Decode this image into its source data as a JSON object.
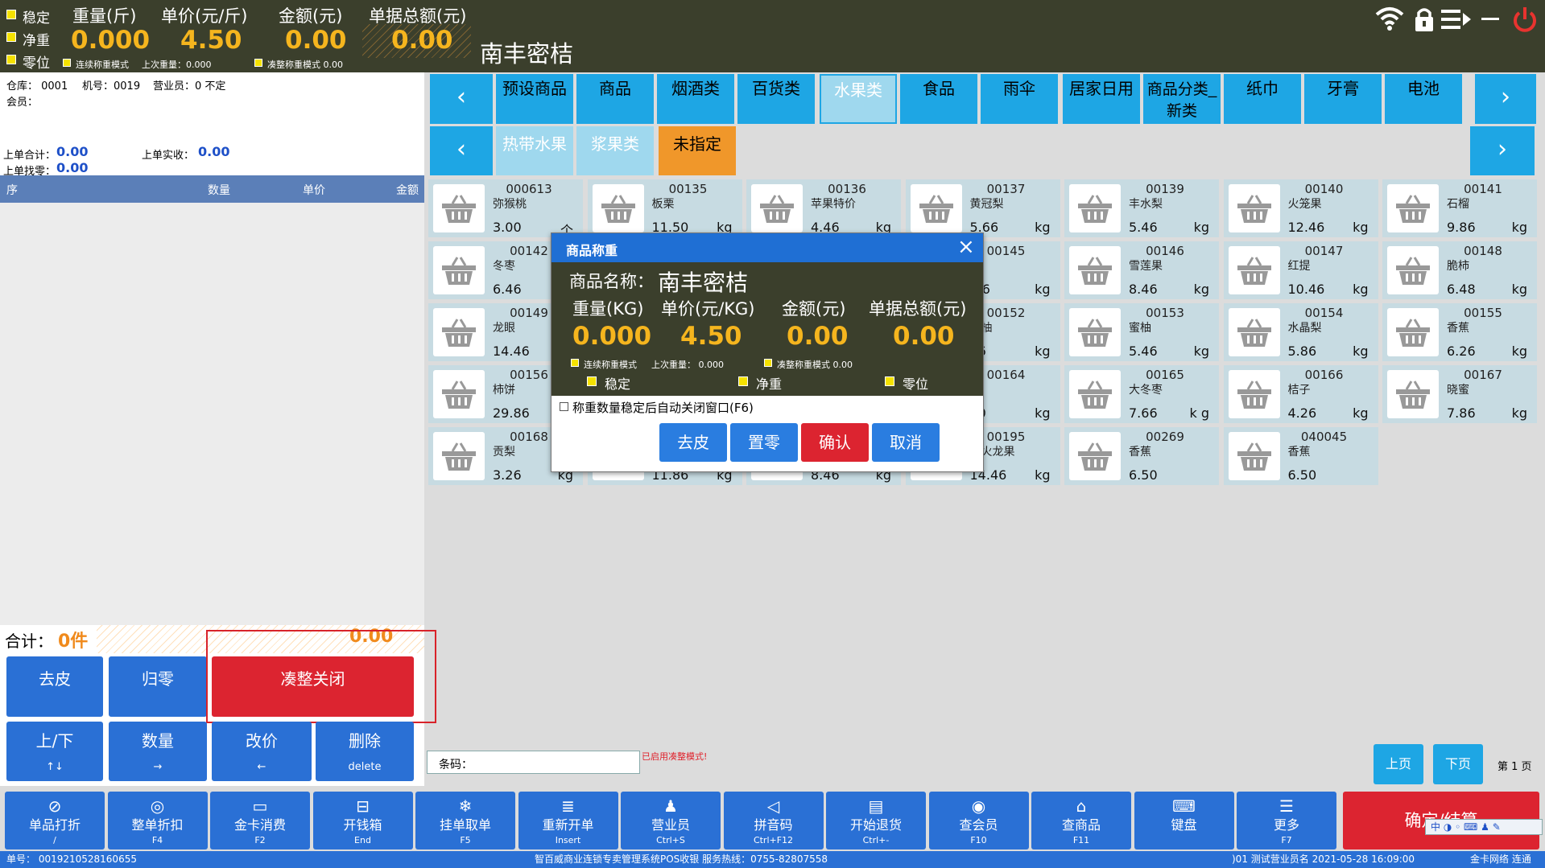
{
  "header": {
    "stable": "稳定",
    "net": "净重",
    "zero": "零位",
    "weight_label": "重量(斤)",
    "weight": "0.000",
    "price_label": "单价(元/斤)",
    "price": "4.50",
    "amount_label": "金额(元)",
    "amount": "0.00",
    "total_label": "单据总额(元)",
    "total": "0.00",
    "cont_mode": "连续称重模式",
    "last_weight": "上次重量：0.000",
    "round_mode": "凑整称重模式 0.00",
    "product_name": "南丰密桔"
  },
  "info": {
    "warehouse": "仓库： 0001",
    "machine": "机号：0019",
    "clerk": "营业员：0 不定",
    "member": "会员：",
    "last_total_label": "上单合计：",
    "last_total": "0.00",
    "last_paid_label": "上单实收：",
    "last_paid": "0.00",
    "last_change_label": "上单找零：",
    "last_change": "0.00"
  },
  "grid_cols": [
    "序",
    "数量",
    "单价",
    "金额"
  ],
  "summary": {
    "label": "合计：",
    "count": "0件",
    "amount": "0.00"
  },
  "left_buttons": [
    {
      "label": "去皮"
    },
    {
      "label": "归零"
    },
    {
      "label": "凑整关闭"
    },
    {
      "label": "上/下",
      "key": "↑↓"
    },
    {
      "label": "数量",
      "key": "→"
    },
    {
      "label": "改价",
      "key": "←"
    },
    {
      "label": "删除",
      "key": "delete"
    }
  ],
  "categories": [
    "预设商品",
    "商品",
    "烟酒类",
    "百货类",
    "水果类",
    "食品",
    "雨伞",
    "居家日用",
    "商品分类_新类",
    "纸巾",
    "牙膏",
    "电池"
  ],
  "subcategories": [
    "热带水果",
    "浆果类",
    "未指定"
  ],
  "products": [
    {
      "code": "000613",
      "name": "弥猴桃",
      "price": "3.00",
      "unit": "个"
    },
    {
      "code": "00135",
      "name": "板栗",
      "price": "11.50",
      "unit": "kg"
    },
    {
      "code": "00136",
      "name": "苹果特价",
      "price": "4.46",
      "unit": "kg"
    },
    {
      "code": "00137",
      "name": "黄冠梨",
      "price": "5.66",
      "unit": "kg"
    },
    {
      "code": "00139",
      "name": "丰水梨",
      "price": "5.46",
      "unit": "kg"
    },
    {
      "code": "00140",
      "name": "火笼果",
      "price": "12.46",
      "unit": "kg"
    },
    {
      "code": "00141",
      "name": "石榴",
      "price": "9.86",
      "unit": "kg"
    },
    {
      "code": "00142",
      "name": "冬枣",
      "price": "6.46",
      "unit": ""
    },
    {
      "code": "",
      "name": "",
      "price": "",
      "unit": ""
    },
    {
      "code": "",
      "name": "",
      "price": "",
      "unit": ""
    },
    {
      "code": "00145",
      "name": "果",
      "price": ".46",
      "unit": "kg"
    },
    {
      "code": "00146",
      "name": "雪莲果",
      "price": "8.46",
      "unit": "kg"
    },
    {
      "code": "00147",
      "name": "红提",
      "price": "10.46",
      "unit": "kg"
    },
    {
      "code": "00148",
      "name": "脆柿",
      "price": "6.48",
      "unit": "kg"
    },
    {
      "code": "00149",
      "name": "龙眼",
      "price": "14.46",
      "unit": ""
    },
    {
      "code": "",
      "name": "",
      "price": "",
      "unit": ""
    },
    {
      "code": "",
      "name": "",
      "price": "",
      "unit": ""
    },
    {
      "code": "00152",
      "name": "肉柚",
      "price": "06",
      "unit": "kg"
    },
    {
      "code": "00153",
      "name": "蜜柚",
      "price": "5.46",
      "unit": "kg"
    },
    {
      "code": "00154",
      "name": "水晶梨",
      "price": "5.86",
      "unit": "kg"
    },
    {
      "code": "00155",
      "name": "香蕉",
      "price": "6.26",
      "unit": "kg"
    },
    {
      "code": "00156",
      "name": "柿饼",
      "price": "29.86",
      "unit": ""
    },
    {
      "code": "",
      "name": "",
      "price": "",
      "unit": ""
    },
    {
      "code": "",
      "name": "",
      "price": "",
      "unit": ""
    },
    {
      "code": "00164",
      "name": "子",
      "price": "50",
      "unit": "kg"
    },
    {
      "code": "00165",
      "name": "大冬枣",
      "price": "7.66",
      "unit": "k g"
    },
    {
      "code": "00166",
      "name": "桔子",
      "price": "4.26",
      "unit": "kg"
    },
    {
      "code": "00167",
      "name": "晓蜜",
      "price": "7.86",
      "unit": "kg"
    },
    {
      "code": "00168",
      "name": "贡梨",
      "price": "3.26",
      "unit": "kg"
    },
    {
      "code": "",
      "name": "",
      "price": "11.86",
      "unit": "kg"
    },
    {
      "code": "",
      "name": "",
      "price": "8.46",
      "unit": "kg"
    },
    {
      "code": "00195",
      "name": "心火龙果",
      "price": "14.46",
      "unit": "kg"
    },
    {
      "code": "00269",
      "name": "香蕉",
      "price": "6.50",
      "unit": ""
    },
    {
      "code": "040045",
      "name": "香蕉",
      "price": "6.50",
      "unit": ""
    }
  ],
  "barcode": {
    "label": "条码：",
    "notice": "已启用凑整模式!"
  },
  "pager": {
    "prev": "上页",
    "next": "下页",
    "page": "第 1 页"
  },
  "toolbar": [
    {
      "label": "单品打折",
      "key": "/",
      "icon": "⊘"
    },
    {
      "label": "整单折扣",
      "key": "F4",
      "icon": "◎"
    },
    {
      "label": "金卡消费",
      "key": "F2",
      "icon": "▭"
    },
    {
      "label": "开钱箱",
      "key": "End",
      "icon": "⊟"
    },
    {
      "label": "挂单取单",
      "key": "F5",
      "icon": "❄"
    },
    {
      "label": "重新开单",
      "key": "Insert",
      "icon": "≣"
    },
    {
      "label": "营业员",
      "key": "Ctrl+S",
      "icon": "♟"
    },
    {
      "label": "拼音码",
      "key": "Ctrl+F12",
      "icon": "◁"
    },
    {
      "label": "开始退货",
      "key": "Ctrl+-",
      "icon": "▤"
    },
    {
      "label": "查会员",
      "key": "F10",
      "icon": "◉"
    },
    {
      "label": "查商品",
      "key": "F11",
      "icon": "⌂"
    },
    {
      "label": "键盘",
      "key": "",
      "icon": "⌨"
    },
    {
      "label": "更多",
      "key": "F7",
      "icon": "☰"
    }
  ],
  "confirm_label": "确定/结算",
  "ime": "中",
  "status": {
    "order": "单号： 0019210528160655",
    "system": "智百威商业连锁专卖管理系统POS收银    服务热线：0755-82807558",
    "clerk": ")01 测试营业员名 2021-05-28 16:09:00",
    "net": "金卡网络 连通"
  },
  "dialog": {
    "title": "商品称重",
    "name_label": "商品名称：",
    "name": "南丰密桔",
    "weight_label": "重量(KG)",
    "weight": "0.000",
    "price_label": "单价(元/KG)",
    "price": "4.50",
    "amount_label": "金额(元)",
    "amount": "0.00",
    "total_label": "单据总额(元)",
    "total": "0.00",
    "cont_mode": "连续称重模式",
    "last_weight": "上次重量：  0.000",
    "round_mode": "凑整称重模式 0.00",
    "stable": "稳定",
    "net": "净重",
    "zero": "零位",
    "auto_close": "称重数量稳定后自动关闭窗口(F6)",
    "tare": "去皮",
    "reset": "置零",
    "ok": "确认",
    "cancel": "取消"
  },
  "colors": {
    "header": "#3b3f2c",
    "accent": "#f5b51e",
    "blue": "#2a70d5",
    "red": "#dc2430",
    "cat": "#1ea6e4"
  }
}
